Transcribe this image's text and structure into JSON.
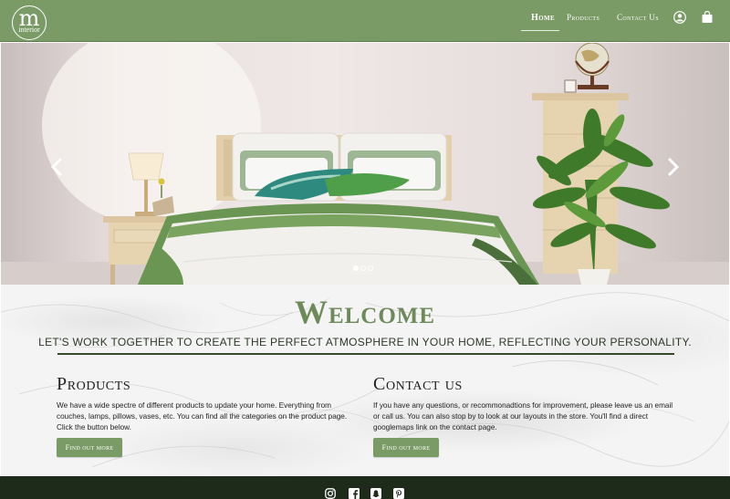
{
  "brand": {
    "logo_letter": "m",
    "logo_word": "interior"
  },
  "nav": {
    "items": [
      {
        "label": "Home",
        "active": true
      },
      {
        "label": "Products",
        "active": false
      },
      {
        "label": "Contact Us",
        "active": false
      }
    ],
    "icons": [
      "user-icon",
      "shopping-bag-icon"
    ]
  },
  "carousel": {
    "slide_count": 3,
    "active_index": 0,
    "prev_icon": "chevron-left-icon",
    "next_icon": "chevron-right-icon"
  },
  "welcome": {
    "title": "Welcome",
    "tagline": "LET'S WORK TOGETHER TO CREATE THE PERFECT ATMOSPHERE IN YOUR HOME, REFLECTING YOUR PERSONALITY."
  },
  "products": {
    "heading": "Products",
    "body": "We have a wide spectre of different products to update your home. Everything from couches, lamps, pillows, vases, etc. You can find all the categories on the product page. Click the button below.",
    "button": "Find out more"
  },
  "contact": {
    "heading": "Contact us",
    "body": "If you have any questions, or recommonadtions for improvement, please leave us an email or call us. You can also stop by to look at our layouts in the store. You'll find a direct googlemaps link on the contact page.",
    "button": "Find out more"
  },
  "footer": {
    "social_icons": [
      "instagram-icon",
      "facebook-icon",
      "snapchat-icon",
      "pinterest-icon"
    ]
  },
  "colors": {
    "brand_green": "#7a9a66",
    "heading_green": "#6e8a5b",
    "footer_dark": "#1e2a1a"
  }
}
